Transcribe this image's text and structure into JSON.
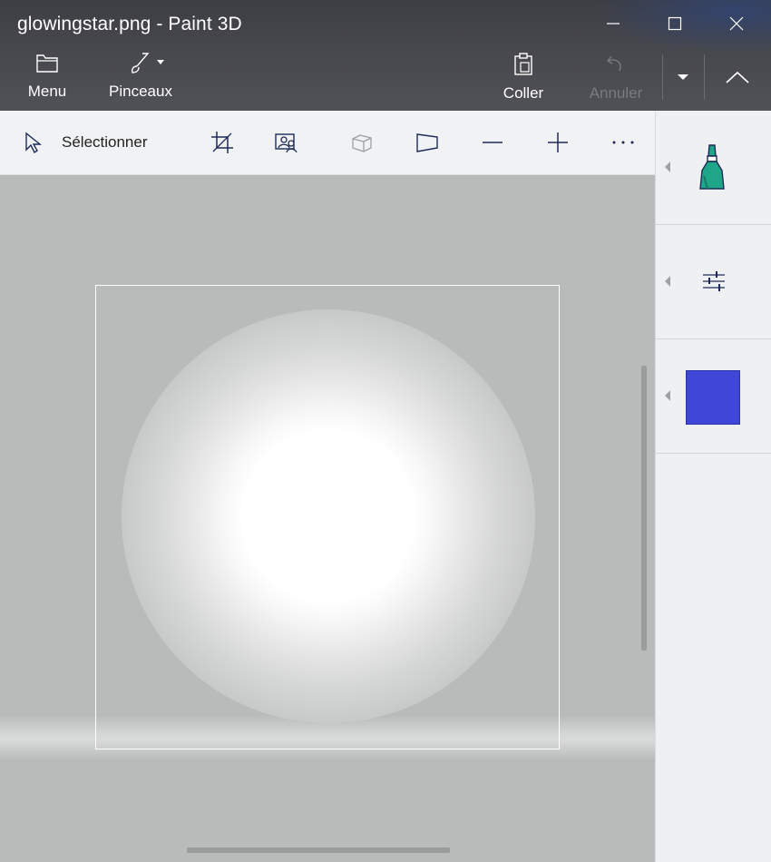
{
  "window": {
    "title": "glowingstar.png - Paint 3D"
  },
  "commands": {
    "menu_label": "Menu",
    "brushes_label": "Pinceaux",
    "paste_label": "Coller",
    "undo_label": "Annuler"
  },
  "toolbar": {
    "select_label": "Sélectionner"
  },
  "icons": {
    "menu": "folder-icon",
    "brushes": "brush-icon",
    "paste": "clipboard-icon",
    "undo": "undo-icon",
    "select": "cursor-arrow-icon",
    "crop": "crop-icon",
    "magic_select": "magic-select-icon",
    "3d_view": "3d-view-icon",
    "perspective": "perspective-icon",
    "zoom_out": "minus-icon",
    "zoom_in": "plus-icon",
    "more": "more-icon",
    "marker": "marker-icon",
    "settings": "sliders-icon"
  },
  "colors": {
    "selected_color": "#4047d8",
    "marker_color": "#1fa588",
    "canvas_background": "#b9baba"
  }
}
